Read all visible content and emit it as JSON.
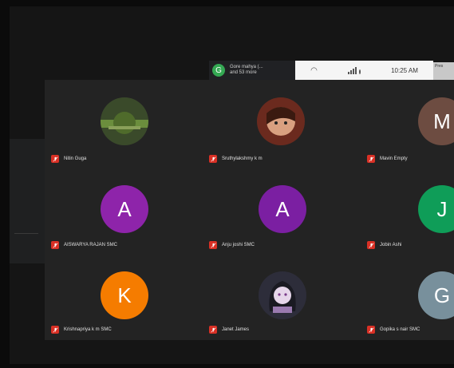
{
  "banner": {
    "initial": "G",
    "line1": "Gore mahya (...",
    "line2": "and 53 more"
  },
  "statusbar": {
    "time": "10:25 AM"
  },
  "corner_label": "Pres",
  "participants": [
    {
      "name": "Nitin Guga",
      "initial": "",
      "photo": "landscape"
    },
    {
      "name": "Sruthylakshmy k m",
      "initial": "",
      "photo": "portrait"
    },
    {
      "name": "Mavin Empty",
      "initial": "M",
      "color": "#6d4c41"
    },
    {
      "name": "AISWARYA RAJAN SMC",
      "initial": "A",
      "color": "#8e24aa"
    },
    {
      "name": "Anju joshi SMC",
      "initial": "A",
      "color": "#7b1fa2"
    },
    {
      "name": "Jobin Ashi",
      "initial": "J",
      "color": "#0f9d58"
    },
    {
      "name": "Krishnapriya k m SMC",
      "initial": "K",
      "color": "#f57c00"
    },
    {
      "name": "Janet James",
      "initial": "",
      "photo": "anime"
    },
    {
      "name": "Gopika s nair SMC",
      "initial": "G",
      "color": "#78909c"
    }
  ]
}
